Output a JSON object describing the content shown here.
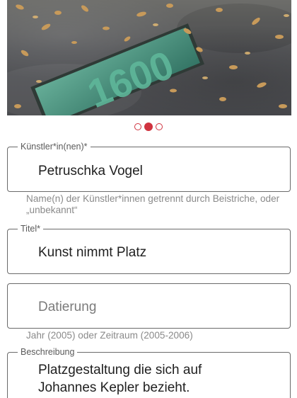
{
  "photo": {
    "plaque_text": "1600",
    "alt": "Bodenplatte mit Zahl 1600 auf Asphalt mit Herbstlaub"
  },
  "pager": {
    "count": 3,
    "active_index": 1
  },
  "artist": {
    "label": "Künstler*in(nen)*",
    "value": "Petruschka Vogel",
    "helper": "Name(n) der Künstler*innen getrennt durch Beistriche, oder „unbekannt“"
  },
  "title": {
    "label": "Titel*",
    "value": "Kunst nimmt Platz"
  },
  "dating": {
    "placeholder": "Datierung",
    "helper": "Jahr (2005) oder Zeitraum (2005-2006)"
  },
  "description": {
    "label": "Beschreibung",
    "value_line1": "Platzgestaltung die sich auf",
    "value_line2": "Johannes Kepler bezieht."
  },
  "colors": {
    "accent": "#d0333f"
  }
}
